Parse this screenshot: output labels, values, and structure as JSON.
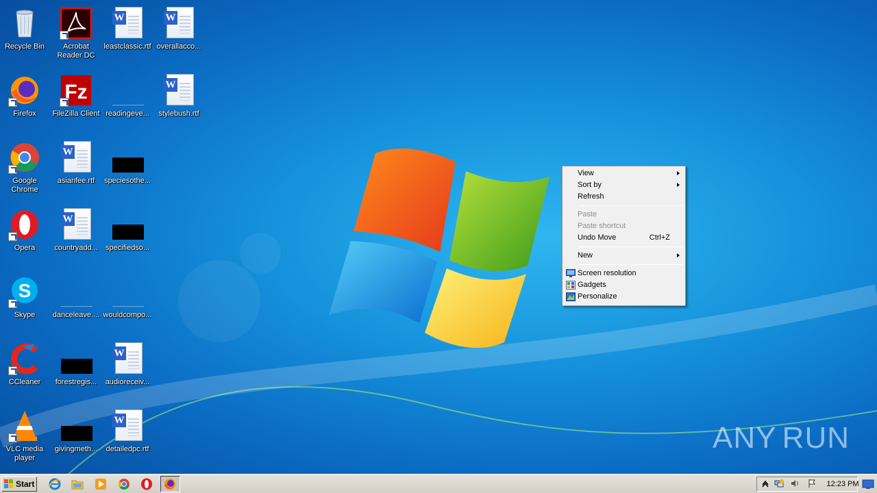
{
  "desktop": {
    "icons": [
      {
        "label": "Recycle Bin",
        "icon": "recycle-bin-icon"
      },
      {
        "label": "Acrobat Reader DC",
        "icon": "acrobat-icon"
      },
      {
        "label": "leastclassic.rtf",
        "icon": "word-doc-icon"
      },
      {
        "label": "overallacco...",
        "icon": "word-doc-icon"
      },
      {
        "label": "Firefox",
        "icon": "firefox-icon"
      },
      {
        "label": "FileZilla Client",
        "icon": "filezilla-icon"
      },
      {
        "label": "readingeve...",
        "icon": "blank-file-icon"
      },
      {
        "label": "stylebush.rtf",
        "icon": "word-doc-icon"
      },
      {
        "label": "Google Chrome",
        "icon": "chrome-icon"
      },
      {
        "label": "asianfee.rtf",
        "icon": "word-doc-icon"
      },
      {
        "label": "speciesothe...",
        "icon": "black-file-icon"
      },
      {
        "label": "Opera",
        "icon": "opera-icon"
      },
      {
        "label": "countryadd...",
        "icon": "word-doc-icon"
      },
      {
        "label": "specifiedso...",
        "icon": "black-file-icon"
      },
      {
        "label": "Skype",
        "icon": "skype-icon"
      },
      {
        "label": "danceleave....",
        "icon": "blank-file-icon"
      },
      {
        "label": "wouldcompo...",
        "icon": "blank-file-icon"
      },
      {
        "label": "CCleaner",
        "icon": "ccleaner-icon"
      },
      {
        "label": "forestregis...",
        "icon": "black-file-icon"
      },
      {
        "label": "audioreceiv...",
        "icon": "word-doc-icon"
      },
      {
        "label": "VLC media player",
        "icon": "vlc-icon"
      },
      {
        "label": "givingmeth...",
        "icon": "black-file-icon"
      },
      {
        "label": "detailedpc.rtf",
        "icon": "word-doc-icon"
      }
    ]
  },
  "context_menu": {
    "view": "View",
    "sort_by": "Sort by",
    "refresh": "Refresh",
    "paste": "Paste",
    "paste_shortcut": "Paste shortcut",
    "undo_move": "Undo Move",
    "undo_move_shortcut": "Ctrl+Z",
    "new": "New",
    "screen_resolution": "Screen resolution",
    "gadgets": "Gadgets",
    "personalize": "Personalize"
  },
  "taskbar": {
    "start_label": "Start",
    "pinned": [
      "internet-explorer-icon",
      "folder-icon",
      "media-player-icon",
      "chrome-icon",
      "opera-icon",
      "firefox-icon"
    ],
    "clock": "12:23 PM"
  },
  "watermark": {
    "left": "ANY",
    "right": "RUN"
  },
  "colors": {
    "desktop_accent": "#1692dc",
    "menu_bg": "#f0f0f0",
    "taskbar_bg": "#d4d0c8"
  }
}
